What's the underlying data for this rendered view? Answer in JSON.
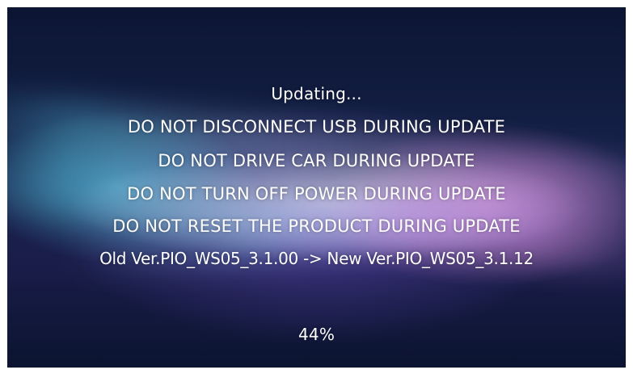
{
  "screen": {
    "status_title": "Updating...",
    "warnings": [
      "DO NOT DISCONNECT USB DURING UPDATE",
      "DO NOT DRIVE CAR DURING UPDATE",
      "DO NOT TURN OFF POWER DURING UPDATE",
      "DO NOT RESET THE PRODUCT DURING UPDATE"
    ],
    "version_line": "Old Ver.PIO_WS05_3.1.00 -> New Ver.PIO_WS05_3.1.12",
    "progress_label": "44%",
    "progress_percent": 44
  },
  "colors": {
    "background_dark": "#0c1533",
    "text": "#ffffff",
    "glow_cyan": "#5ac8e6",
    "glow_magenta": "#e68cdc"
  }
}
